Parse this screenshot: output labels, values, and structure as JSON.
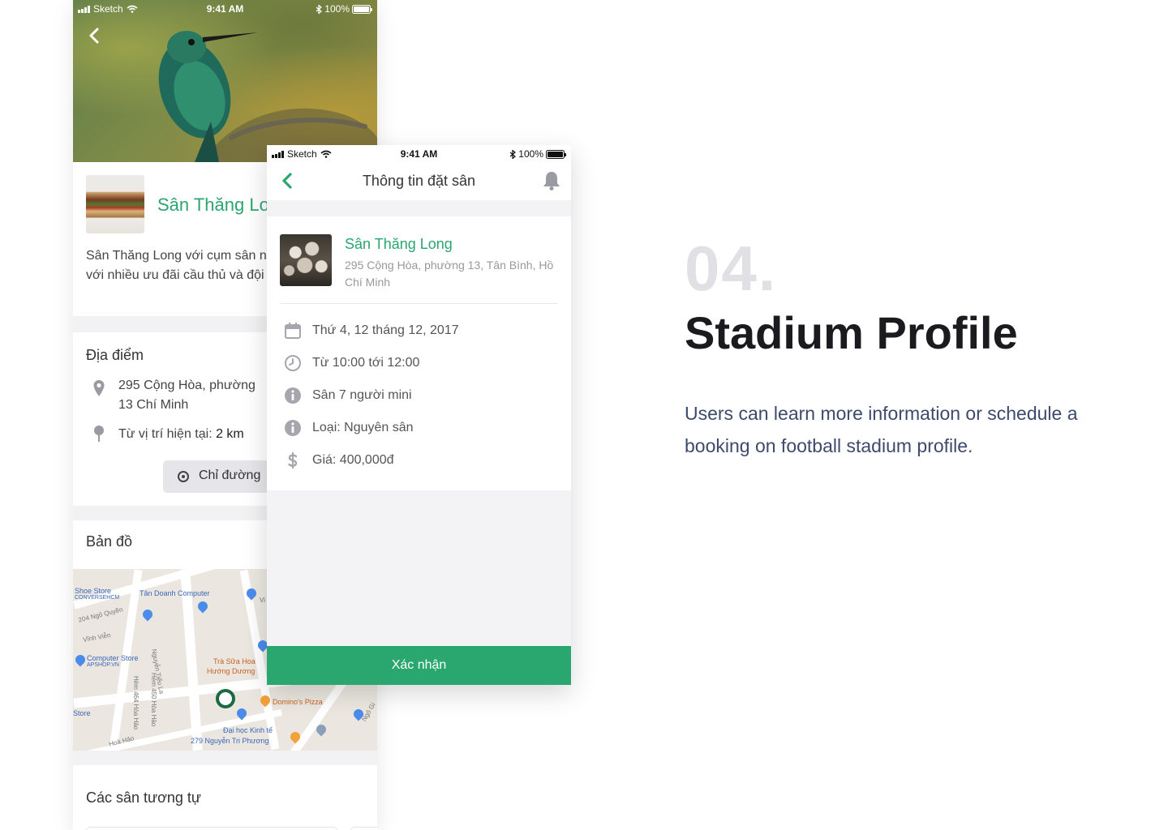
{
  "profile": {
    "status": {
      "carrier": "Sketch",
      "time": "9:41 AM",
      "battery": "100%"
    },
    "stadium_name": "Sân Thăng Long",
    "description": "Sân Thăng Long với cụm sân ng tâm Tân Bình, với nhiều ưu đãi cầu thủ và đội bóng.",
    "location_heading": "Địa điểm",
    "address": "295 Cộng Hòa, phường 13 Chí Minh",
    "distance_label": "Từ vị trí hiện tại: ",
    "distance_value": "2 km",
    "directions_button": "Chỉ đường",
    "map_heading": "Bản đồ",
    "similar_heading": "Các sân tương tự",
    "map_labels": {
      "shoe_store": "Shoe Store",
      "converse": "CONVERSEHCM",
      "tan_doanh": "Tân Doanh Computer",
      "ngo_quyen": "204 Ngô Quyền",
      "vinh_vien": "Vĩnh Viễn",
      "computer_store": "Computer Store",
      "apshop": "APSHOP.VN",
      "nguyen_tieu_la": "Nguyễn Tiểu La",
      "tra_sua": "Trà Sữa Hoa",
      "huong_duong": "Hướng Dương",
      "dominos": "Domino's Pizza",
      "hem_464": "Hẻm 464 Hòa Hảo",
      "hem_450": "Hẻm 450 Hòa Hảo",
      "store": "Store",
      "dai_hoc": "Đại học Kinh tế",
      "nguyen_tri_phuong": "279 Nguyễn Tri Phương",
      "hoa_hao": "Hoà Hảo",
      "ngo_gia": "Ngô Gi",
      "vi": "Vi"
    }
  },
  "booking": {
    "status": {
      "carrier": "Sketch",
      "time": "9:41 AM",
      "battery": "100%"
    },
    "nav_title": "Thông tin đặt sân",
    "stadium_name": "Sân Thăng Long",
    "address": "295 Cộng Hòa, phường 13, Tân Bình, Hồ Chí Minh",
    "date": "Thứ 4, 12 tháng 12, 2017",
    "time": "Từ 10:00 tới 12:00",
    "field_type": "Sân 7 người mini",
    "kind": "Loại: Nguyên sân",
    "price": "Giá: 400,000đ",
    "confirm_button": "Xác nhận"
  },
  "showcase": {
    "number": "04.",
    "title": "Stadium Profile",
    "description": "Users can learn more information or schedule a booking on football stadium profile."
  },
  "colors": {
    "accent": "#2aa66f",
    "heading": "#1b1b1f",
    "body": "#3e4a6b",
    "number": "#e1e1e5"
  },
  "icons": [
    "back-chevron-icon",
    "bell-icon",
    "calendar-icon",
    "clock-icon",
    "info-icon",
    "dollar-icon",
    "location-pin-icon",
    "compass-icon",
    "wifi-icon",
    "bluetooth-icon",
    "battery-icon",
    "signal-icon"
  ]
}
